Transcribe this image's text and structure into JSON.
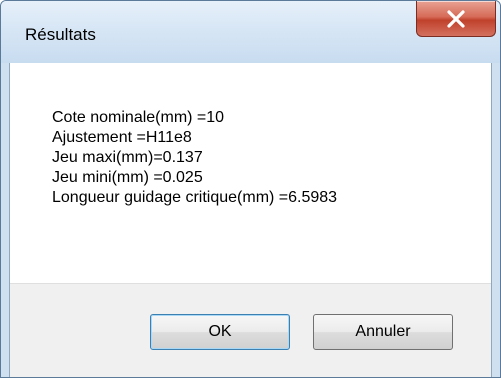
{
  "window": {
    "title": "Résultats"
  },
  "titlebar": {
    "close_icon": "close-icon"
  },
  "content": {
    "lines": [
      "Cote nominale(mm) =10",
      "Ajustement =H11e8",
      "Jeu maxi(mm)=0.137",
      "Jeu mini(mm) =0.025",
      "Longueur guidage critique(mm) =6.5983"
    ]
  },
  "buttons": {
    "ok_label": "OK",
    "cancel_label": "Annuler"
  },
  "colors": {
    "titlebar": "#d7e6f5",
    "close_button": "#c0412c",
    "footer": "#f0f0f0",
    "default_button_border": "#3c7fb1"
  }
}
